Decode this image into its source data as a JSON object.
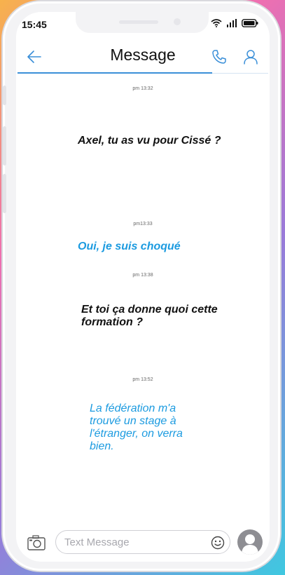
{
  "status_bar": {
    "time": "15:45"
  },
  "header": {
    "title": "Message",
    "back_icon": "arrow-left-icon",
    "call_icon": "phone-icon",
    "contact_icon": "person-icon",
    "accent_color": "#3a8fd8"
  },
  "conversation": {
    "messages": [
      {
        "timestamp": "pm 13:32",
        "text": "Axel, tu as vu pour Cissé ?",
        "direction": "received"
      },
      {
        "timestamp": "pm13:33",
        "text": "Oui, je suis choqué",
        "direction": "sent"
      },
      {
        "timestamp": "pm 13:38",
        "text": "Et toi ça donne quoi cette formation ?",
        "direction": "received"
      },
      {
        "timestamp": "pm 13:52",
        "text": "La fédération m'a trouvé un stage à l'étranger, on verra bien.",
        "direction": "sent"
      }
    ],
    "sent_color": "#1c9be0",
    "received_color": "#111111"
  },
  "composer": {
    "placeholder": "Text Message",
    "camera_icon": "camera-icon",
    "emoji_icon": "smiley-icon",
    "avatar_icon": "avatar-icon"
  }
}
